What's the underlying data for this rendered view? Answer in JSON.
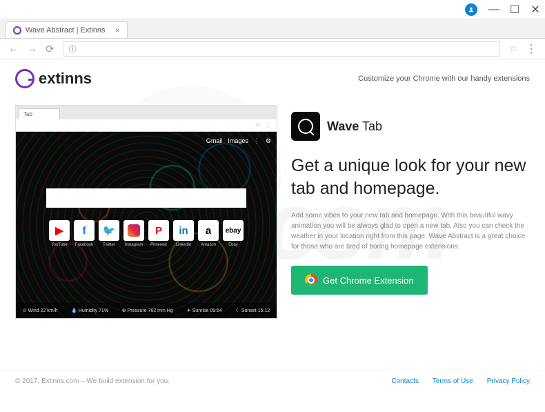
{
  "window": {
    "tab_title": "Wave Abstract | Extinns"
  },
  "header": {
    "brand": "extinns",
    "tagline": "Customize your Chrome with our handy extensions"
  },
  "preview": {
    "tab": "Tab",
    "top_right": [
      "Gmail",
      "Images",
      "⋮",
      "⚙"
    ],
    "icons": [
      {
        "lbl": "YouTube",
        "cls": "yt",
        "g": "▶"
      },
      {
        "lbl": "Facebook",
        "cls": "fb",
        "g": "f"
      },
      {
        "lbl": "Twitter",
        "cls": "tw",
        "g": "🐦"
      },
      {
        "lbl": "Instagram",
        "cls": "ig",
        "g": ""
      },
      {
        "lbl": "Pinterest",
        "cls": "pin",
        "g": "P"
      },
      {
        "lbl": "LinkedIn",
        "cls": "li",
        "g": "in"
      },
      {
        "lbl": "Amazon",
        "cls": "am",
        "g": "a"
      },
      {
        "lbl": "Ebay",
        "cls": "eb",
        "g": "ebay"
      }
    ],
    "bottom": [
      "⊙ Wind 22 km/h",
      "💧 Humidity 71%",
      "⊕ Pressure 762 mm Hg",
      "☀ Sunrise 09:54",
      "☾ Sunset 15:12"
    ]
  },
  "app": {
    "name_bold": "Wave",
    "name_rest": "Tab",
    "headline": "Get a unique look for your new tab and homepage.",
    "desc": "Add some vibes to your new tab and homepage. With this beautiful wavy animation you will be always glad to open a new tab. Also you can check the weather in your location right from this page. Wave Abstract is a great choice for those who are tired of boring homepage extensions.",
    "cta": "Get Chrome Extension"
  },
  "footer": {
    "copy": "© 2017, Extinns.com – We build extension for you.",
    "links": [
      "Contacts",
      "Terms of Use",
      "Privacy Policy"
    ]
  }
}
